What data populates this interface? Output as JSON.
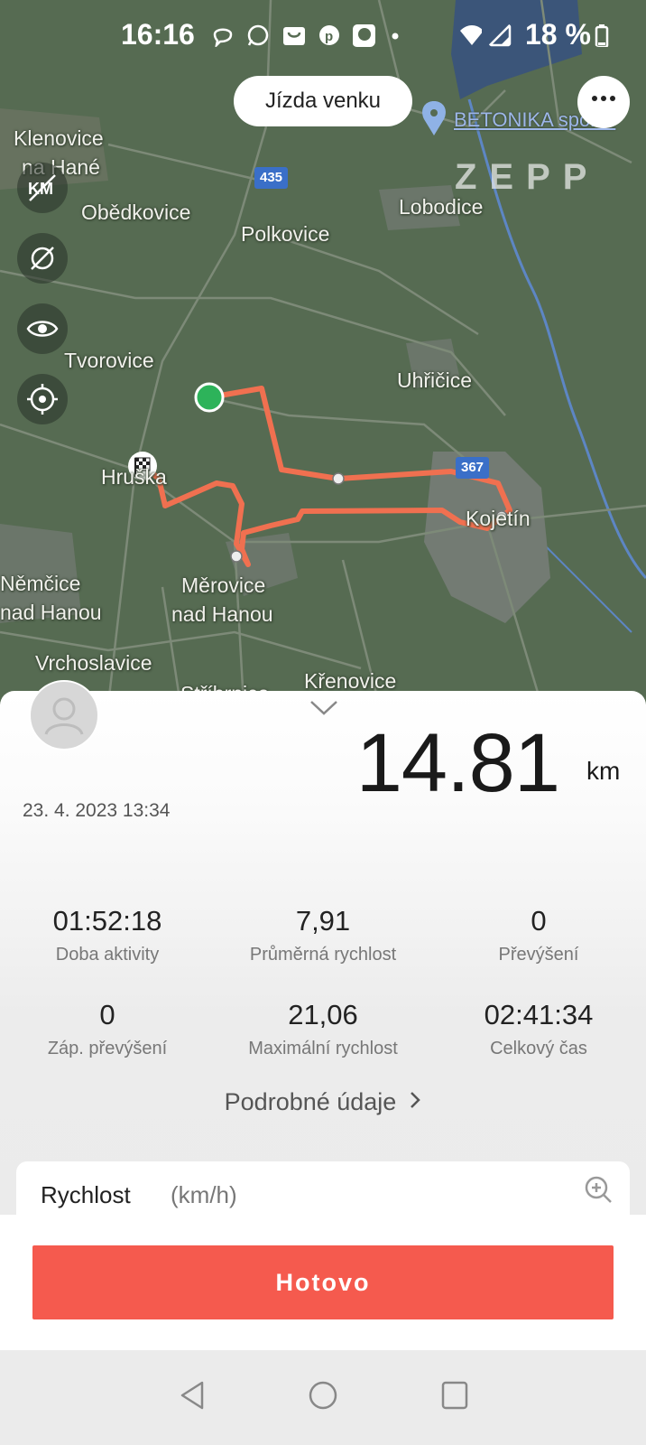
{
  "status_bar": {
    "time": "16:16",
    "battery": "18 %",
    "notification_icons": [
      "viber-icon",
      "whatsapp-icon",
      "shopping-bag-icon",
      "pinterest-icon",
      "lidl-plus-icon"
    ]
  },
  "map": {
    "activity_type": "Jízda venku",
    "poi_name": "BETONIKA spol. s",
    "logo_text": "ZEPP",
    "places": [
      {
        "name": "Klenovice",
        "id": "klenovice"
      },
      {
        "name": "na Hané",
        "id": "na-hane"
      },
      {
        "name": "Obědkovice",
        "id": "obedkovice"
      },
      {
        "name": "Polkovice",
        "id": "polkovice"
      },
      {
        "name": "Lobodice",
        "id": "lobodice"
      },
      {
        "name": "Tvorovice",
        "id": "tvorovice"
      },
      {
        "name": "Uhřičice",
        "id": "uhricice"
      },
      {
        "name": "Hruška",
        "id": "hruska"
      },
      {
        "name": "Kojetín",
        "id": "kojetin"
      },
      {
        "name": "Němčice",
        "id": "nemcice"
      },
      {
        "name": "nad Hanou",
        "id": "nemcice-nad-hanou"
      },
      {
        "name": "Měrovice",
        "id": "merovice"
      },
      {
        "name": "nad Hanou",
        "id": "merovice-nad-hanou"
      },
      {
        "name": "Vrchoslavice",
        "id": "vrchoslavice"
      },
      {
        "name": "Křenovice",
        "id": "krenovice"
      },
      {
        "name": "Stříbrnice",
        "id": "stribrnice"
      }
    ],
    "road_numbers": [
      "435",
      "367"
    ],
    "controls": [
      "km-toggle-icon",
      "hide-markers-icon",
      "eye-icon",
      "locate-icon"
    ]
  },
  "summary": {
    "distance": "14.81",
    "distance_unit": "km",
    "date": "23. 4. 2023 13:34",
    "stats": [
      {
        "value": "01:52:18",
        "label": "Doba aktivity"
      },
      {
        "value": "7,91",
        "label": "Průměrná rychlost"
      },
      {
        "value": "0",
        "label": "Převýšení"
      },
      {
        "value": "0",
        "label": "Záp. převýšení"
      },
      {
        "value": "21,06",
        "label": "Maximální rychlost"
      },
      {
        "value": "02:41:34",
        "label": "Celkový čas"
      }
    ],
    "details_link": "Podrobné údaje"
  },
  "speed_chart": {
    "title": "Rychlost",
    "unit": "(km/h)"
  },
  "footer": {
    "done_label": "Hotovo"
  },
  "colors": {
    "accent": "#f55a4e",
    "route": "#f07050",
    "map_bg": "#566b52",
    "start_marker": "#2db35a"
  }
}
